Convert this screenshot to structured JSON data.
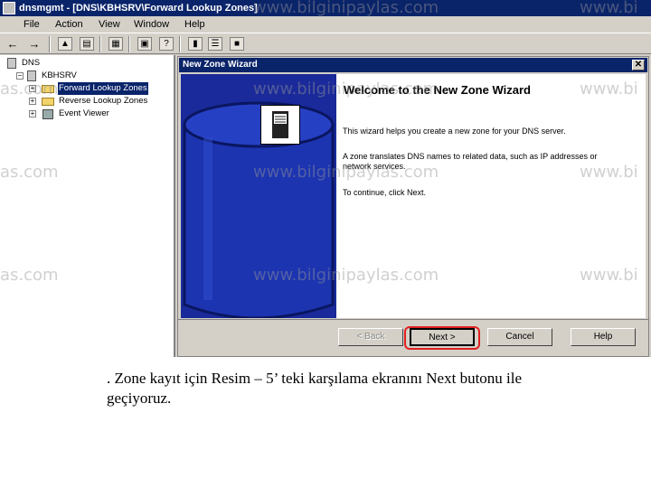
{
  "window": {
    "title": "dnsmgmt - [DNS\\KBHSRV\\Forward Lookup Zones]"
  },
  "menu": [
    "File",
    "Action",
    "View",
    "Window",
    "Help"
  ],
  "tree": {
    "root": "DNS",
    "server": "KBHSRV",
    "items": [
      "Forward Lookup Zones",
      "Reverse Lookup Zones",
      "Event Viewer"
    ]
  },
  "dialog": {
    "title": "New Zone Wizard",
    "close": "✕",
    "heading": "Welcome to the New Zone Wizard",
    "para1": "This wizard helps you create a new zone for your DNS server.",
    "para2": "A zone translates DNS names to related data, such as IP addresses or network services.",
    "para3": "To continue, click Next.",
    "buttons": {
      "back": "< Back",
      "next": "Next >",
      "cancel": "Cancel",
      "help": "Help"
    }
  },
  "watermarks": [
    "www.bilginipaylas.com",
    "www.bilginipaylas.com",
    "www.bilginipaylas.com",
    "www.bilginipaylas.com",
    "www.bi",
    "www.bi",
    "www.bi",
    "www.bi",
    "as.com",
    "as.com",
    "as.com"
  ],
  "caption": ". Zone kayıt için Resim – 5’ teki karşılama ekranını Next butonu ile geçiyoruz.",
  "colors": {
    "titlebar": "#0a246a",
    "banner": "#1a2a9a",
    "highlight": "#e02020"
  }
}
